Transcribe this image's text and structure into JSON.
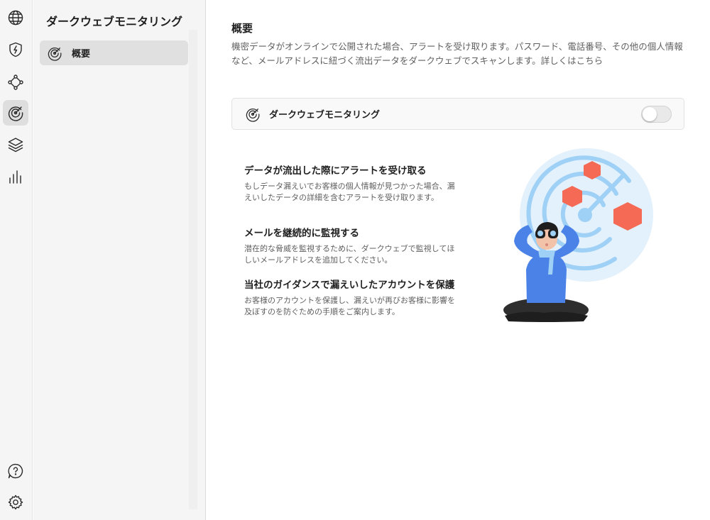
{
  "sidebar": {
    "title": "ダークウェブモニタリング",
    "items": [
      {
        "label": "概要",
        "icon": "radar-icon",
        "active": true
      }
    ]
  },
  "rail": {
    "items": [
      {
        "icon": "globe-icon",
        "active": false
      },
      {
        "icon": "shield-bolt-icon",
        "active": false
      },
      {
        "icon": "nodes-icon",
        "active": false
      },
      {
        "icon": "radar-icon",
        "active": true
      },
      {
        "icon": "layers-icon",
        "active": false
      },
      {
        "icon": "bar-chart-icon",
        "active": false
      },
      {
        "icon": "help-icon",
        "active": false
      },
      {
        "icon": "gear-icon",
        "active": false
      }
    ]
  },
  "main": {
    "title": "概要",
    "description": "機密データがオンラインで公開された場合、アラートを受け取ります。パスワード、電話番号、その他の個人情報など、メールアドレスに紐づく流出データをダークウェブでスキャンします。詳しくはこちら",
    "toggle": {
      "label": "ダークウェブモニタリング",
      "enabled": false
    },
    "features": [
      {
        "title": "データが流出した際にアラートを受け取る",
        "description": "もしデータ漏えいでお客様の個人情報が見つかった場合、漏えいしたデータの詳細を含むアラートを受け取ります。"
      },
      {
        "title": "メールを継続的に監視する",
        "description": "潜在的な脅威を監視するために、ダークウェブで監視してほしいメールアドレスを追加してください。"
      },
      {
        "title": "当社のガイダンスで漏えいしたアカウントを保護",
        "description": "お客様のアカウントを保護し、漏えいが再びお客様に影響を及ぼすのを防ぐための手順をご案内します。"
      }
    ]
  },
  "colors": {
    "accent_blue": "#4a82e8",
    "radar_blue": "#9fd0f6",
    "radar_bg": "#e3f1fc",
    "hex_red": "#f46a54"
  }
}
